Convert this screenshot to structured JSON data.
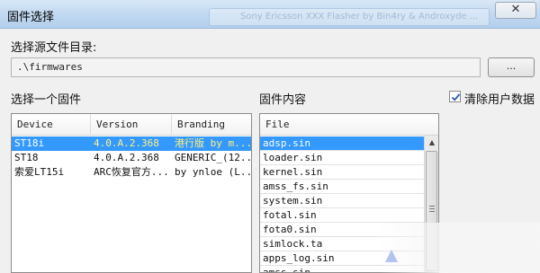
{
  "window": {
    "title": "固件选择",
    "close_glyph": "✕",
    "background_tab_text": "Sony Ericsson XXX Flasher by Bin4ry & Androxyde ..."
  },
  "source": {
    "label": "选择源文件目录:",
    "path_value": ".\\firmwares",
    "browse_label": "..."
  },
  "firmware_list": {
    "label": "选择一个固件",
    "columns": [
      "Device",
      "Version",
      "Branding"
    ],
    "rows": [
      {
        "device": "ST18i",
        "version": "4.0.A.2.368",
        "branding": "港行版 by m...",
        "selected": true
      },
      {
        "device": "ST18",
        "version": "4.0.A.2.368",
        "branding": "GENERIC_(12...",
        "selected": false
      },
      {
        "device": "索爱LT15i",
        "version": "ARC恢复官方...",
        "branding": "by ynloe (L...",
        "selected": false
      }
    ]
  },
  "firmware_content": {
    "label": "固件内容",
    "column": "File",
    "files": [
      "adsp.sin",
      "loader.sin",
      "kernel.sin",
      "amss_fs.sin",
      "system.sin",
      "fotal.sin",
      "fota0.sin",
      "simlock.ta",
      "apps_log.sin",
      "amss.sin"
    ],
    "selected_index": 0
  },
  "options": {
    "clear_user_data_label": "清除用户数据",
    "clear_user_data_checked": true
  },
  "colors": {
    "selection": "#3399ff",
    "selection_highlight_text": "#fff17a",
    "titlebar": "#c3daf1"
  }
}
